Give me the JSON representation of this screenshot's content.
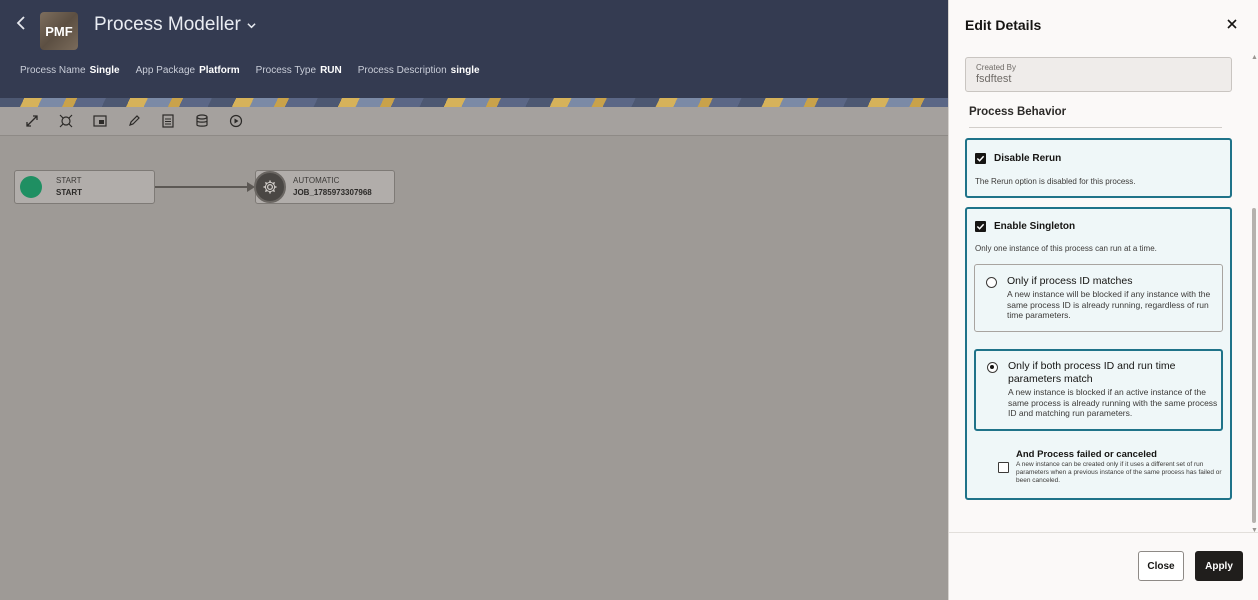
{
  "header": {
    "logo_text": "PMF",
    "title": "Process Modeller",
    "meta": [
      {
        "label": "Process Name",
        "value": "Single"
      },
      {
        "label": "App Package",
        "value": "Platform"
      },
      {
        "label": "Process Type",
        "value": "RUN"
      },
      {
        "label": "Process Description",
        "value": "single"
      }
    ]
  },
  "toolbar": {
    "icons": [
      "expand-icon",
      "fit-icon",
      "screen-icon",
      "edit-icon",
      "document-icon",
      "database-icon",
      "play-icon"
    ]
  },
  "canvas": {
    "nodes": [
      {
        "type": "START",
        "name": "START"
      },
      {
        "type": "AUTOMATIC",
        "name": "JOB_1785973307968"
      }
    ]
  },
  "drawer": {
    "title": "Edit Details",
    "created_by": {
      "label": "Created By",
      "value": "fsdftest"
    },
    "section_title": "Process Behavior",
    "disable_rerun": {
      "label": "Disable Rerun",
      "checked": true,
      "help": "The Rerun option is disabled for this process."
    },
    "enable_singleton": {
      "label": "Enable Singleton",
      "checked": true,
      "help": "Only one instance of this process can run at a time.",
      "options": [
        {
          "title": "Only if process ID matches",
          "desc": "A new instance will be blocked if any instance with the same process ID is already running, regardless of run time parameters.",
          "selected": false
        },
        {
          "title": "Only if both process ID and run time parameters match",
          "desc": "A new instance is blocked if an active instance of the same process is already running with the same process ID and matching run parameters.",
          "selected": true
        }
      ],
      "sub_option": {
        "title": "And Process failed or canceled",
        "desc": "A new instance can be created only if it uses a different set of run parameters when a previous instance of the same process has failed or been canceled.",
        "checked": false
      }
    },
    "buttons": {
      "close": "Close",
      "apply": "Apply"
    }
  },
  "colors": {
    "header_bg": "#343b51",
    "accent": "#1f7389",
    "start_green": "#1f8f62",
    "canvas_bg": "#9e9a96"
  }
}
